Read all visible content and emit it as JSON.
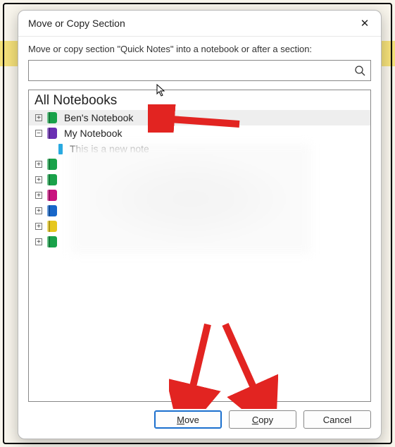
{
  "dialog": {
    "title": "Move or Copy Section",
    "instruction": "Move or copy section \"Quick Notes\" into a notebook or after a section:",
    "search_value": "",
    "list_header": "All Notebooks",
    "buttons": {
      "move": "Move",
      "copy": "Copy",
      "cancel": "Cancel"
    }
  },
  "tree": {
    "items": [
      {
        "type": "notebook",
        "label": "Ben's Notebook",
        "color": "#19a24a",
        "expander": "plus",
        "selected": true
      },
      {
        "type": "notebook",
        "label": "My Notebook",
        "color": "#6a2fb3",
        "expander": "minus",
        "selected": false,
        "children": [
          {
            "type": "section",
            "label": "This is a new note",
            "color": "#29a9e0"
          }
        ]
      },
      {
        "type": "notebook",
        "label": "",
        "color": "#19a24a",
        "expander": "plus",
        "redacted": true
      },
      {
        "type": "notebook",
        "label": "",
        "color": "#19a24a",
        "expander": "plus",
        "redacted": true
      },
      {
        "type": "notebook",
        "label": "",
        "color": "#c9127f",
        "expander": "plus",
        "redacted": true
      },
      {
        "type": "notebook",
        "label": "",
        "color": "#1766c9",
        "expander": "plus",
        "redacted": true
      },
      {
        "type": "notebook",
        "label": "",
        "color": "#e6c71d",
        "expander": "plus",
        "redacted": true
      },
      {
        "type": "notebook",
        "label": "",
        "color": "#19a24a",
        "expander": "plus",
        "redacted": true
      }
    ]
  },
  "icons": {
    "close": "✕",
    "search": "⌕",
    "plus": "+",
    "minus": "−"
  },
  "annotations": {
    "arrows_color": "#e22421"
  }
}
